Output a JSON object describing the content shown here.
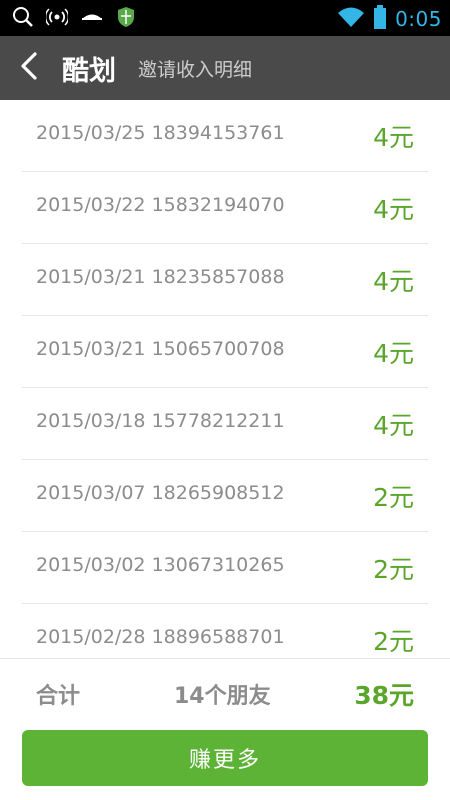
{
  "status_bar": {
    "time": "0:05",
    "icons": [
      "search-icon",
      "signal-broadcast-icon",
      "cloud-icon",
      "shield-icon",
      "wifi-icon",
      "battery-icon"
    ],
    "clock_color": "#33b5e5"
  },
  "action_bar": {
    "app_title": "酷划",
    "page_title": "邀请收入明细"
  },
  "records": [
    {
      "date": "2015/03/25",
      "phone": "18394153761",
      "amount": "4元"
    },
    {
      "date": "2015/03/22",
      "phone": "15832194070",
      "amount": "4元"
    },
    {
      "date": "2015/03/21",
      "phone": "18235857088",
      "amount": "4元"
    },
    {
      "date": "2015/03/21",
      "phone": "15065700708",
      "amount": "4元"
    },
    {
      "date": "2015/03/18",
      "phone": "15778212211",
      "amount": "4元"
    },
    {
      "date": "2015/03/07",
      "phone": "18265908512",
      "amount": "2元"
    },
    {
      "date": "2015/03/02",
      "phone": "13067310265",
      "amount": "2元"
    },
    {
      "date": "2015/02/28",
      "phone": "18896588701",
      "amount": "2元"
    }
  ],
  "summary": {
    "label": "合计",
    "friends": "14个朋友",
    "total": "38元"
  },
  "earn_more_label": "赚更多",
  "colors": {
    "accent_green": "#5aa62a",
    "button_green": "#5cb336",
    "action_bar": "#4a4a4a"
  }
}
